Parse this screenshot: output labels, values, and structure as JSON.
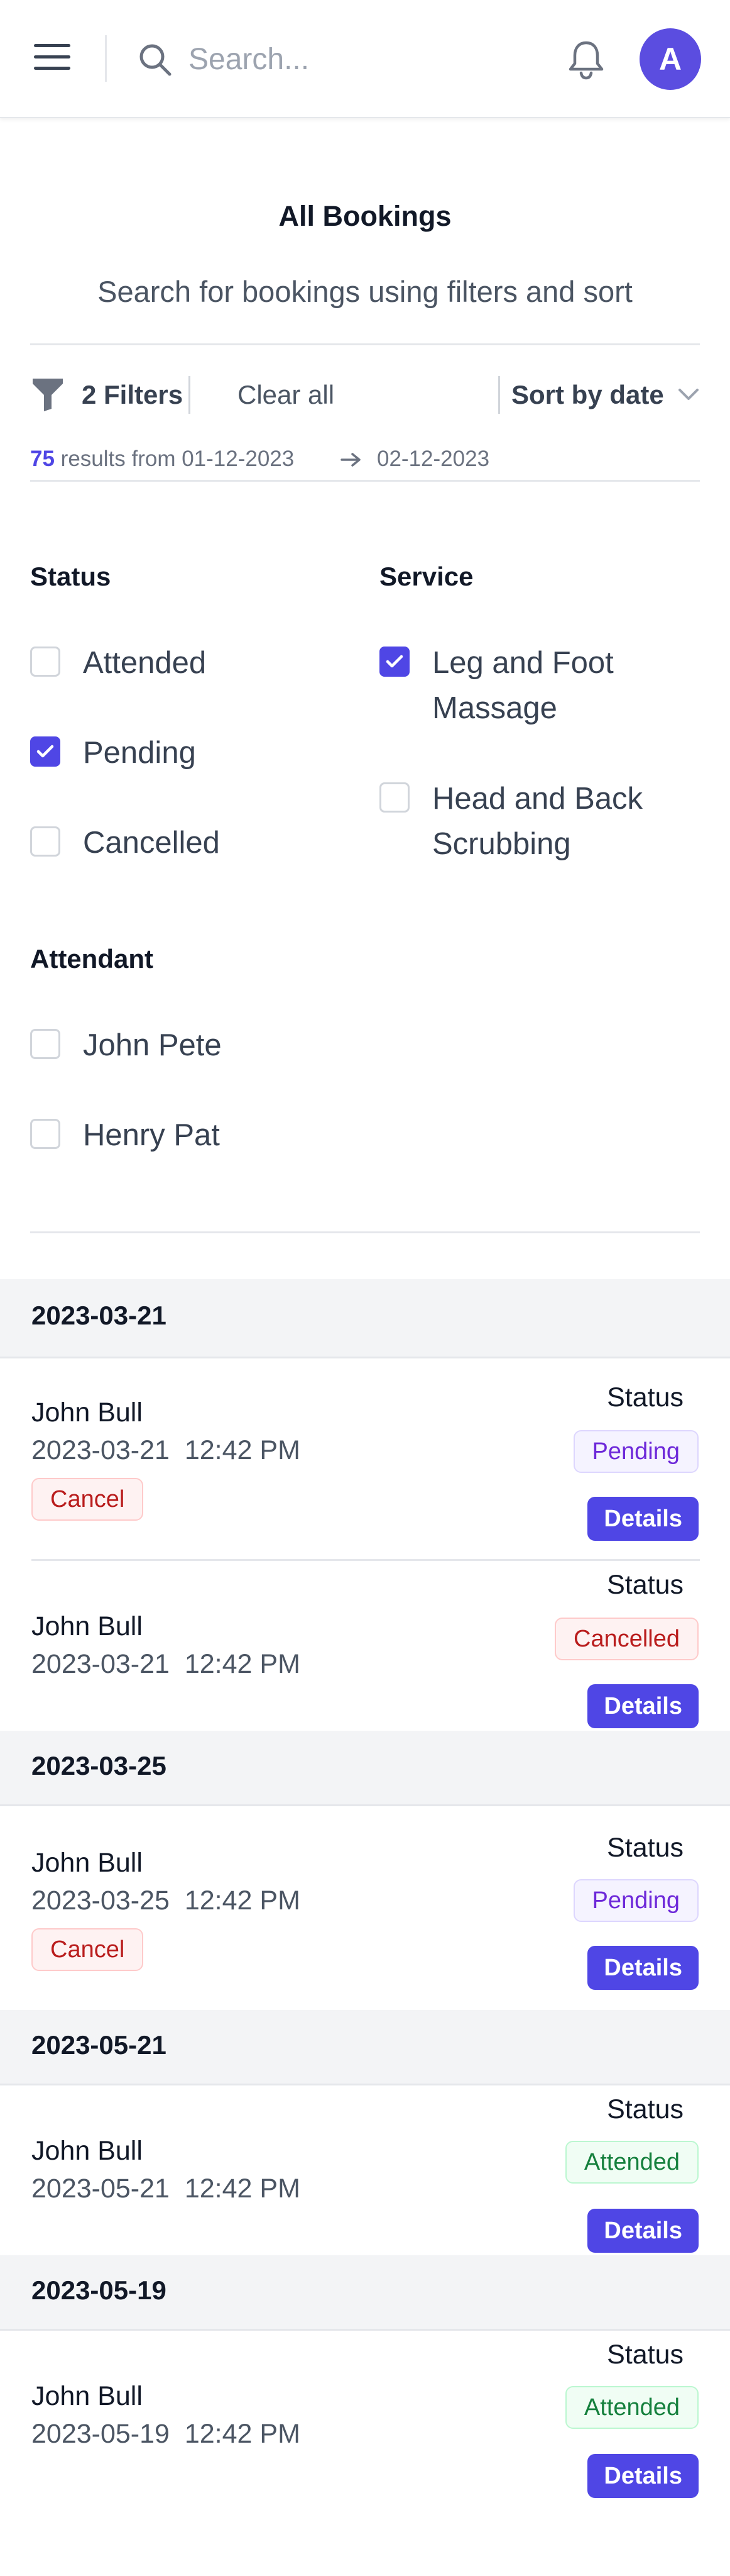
{
  "header": {
    "search_placeholder": "Search...",
    "avatar_initial": "A",
    "icons": [
      "menu-icon",
      "search-icon",
      "bell-icon"
    ]
  },
  "page": {
    "title": "All Bookings",
    "subtitle": "Search for bookings using filters and sort"
  },
  "toolbar": {
    "filters_label": "2 Filters",
    "clear_all_label": "Clear all",
    "sort_label": "Sort by date"
  },
  "results": {
    "count": "75",
    "text": "results from 01-12-2023",
    "date_end": "02-12-2023"
  },
  "filters": {
    "status": {
      "title": "Status",
      "options": [
        {
          "label": "Attended",
          "checked": false
        },
        {
          "label": "Pending",
          "checked": true
        },
        {
          "label": "Cancelled",
          "checked": false
        }
      ]
    },
    "service": {
      "title": "Service",
      "options": [
        {
          "label": "Leg and Foot Massage",
          "checked": true
        },
        {
          "label": "Head and Back Scrubbing",
          "checked": false
        }
      ]
    },
    "attendant": {
      "title": "Attendant",
      "options": [
        {
          "label": "John Pete",
          "checked": false
        },
        {
          "label": "Henry Pat",
          "checked": false
        }
      ]
    }
  },
  "booking_groups": [
    {
      "date": "2023-03-21",
      "bookings": [
        {
          "name": "John Bull",
          "datetime": "2023-03-21  12:42 PM",
          "status_label": "Status",
          "status": "Pending",
          "cancel_label": "Cancel",
          "details_label": "Details"
        },
        {
          "name": "John Bull",
          "datetime": "2023-03-21  12:42 PM",
          "status_label": "Status",
          "status": "Cancelled",
          "details_label": "Details"
        }
      ]
    },
    {
      "date": "2023-03-25",
      "bookings": [
        {
          "name": "John Bull",
          "datetime": "2023-03-25  12:42 PM",
          "status_label": "Status",
          "status": "Pending",
          "cancel_label": "Cancel",
          "details_label": "Details"
        }
      ]
    },
    {
      "date": "2023-05-21",
      "bookings": [
        {
          "name": "John Bull",
          "datetime": "2023-05-21  12:42 PM",
          "status_label": "Status",
          "status": "Attended",
          "details_label": "Details"
        }
      ]
    },
    {
      "date": "2023-05-19",
      "bookings": [
        {
          "name": "John Bull",
          "datetime": "2023-05-19  12:42 PM",
          "status_label": "Status",
          "status": "Attended",
          "details_label": "Details"
        }
      ]
    }
  ],
  "colors": {
    "accent": "#4f46e5",
    "pending": "#6d28d9",
    "cancelled": "#b91c1c",
    "attended": "#15803d"
  }
}
